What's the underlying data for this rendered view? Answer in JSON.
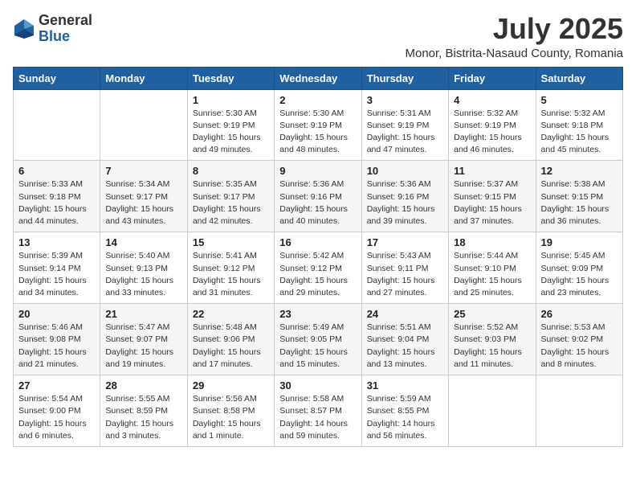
{
  "header": {
    "logo_general": "General",
    "logo_blue": "Blue",
    "month_year": "July 2025",
    "location": "Monor, Bistrita-Nasaud County, Romania"
  },
  "weekdays": [
    "Sunday",
    "Monday",
    "Tuesday",
    "Wednesday",
    "Thursday",
    "Friday",
    "Saturday"
  ],
  "weeks": [
    [
      {
        "day": "",
        "info": ""
      },
      {
        "day": "",
        "info": ""
      },
      {
        "day": "1",
        "info": "Sunrise: 5:30 AM\nSunset: 9:19 PM\nDaylight: 15 hours\nand 49 minutes."
      },
      {
        "day": "2",
        "info": "Sunrise: 5:30 AM\nSunset: 9:19 PM\nDaylight: 15 hours\nand 48 minutes."
      },
      {
        "day": "3",
        "info": "Sunrise: 5:31 AM\nSunset: 9:19 PM\nDaylight: 15 hours\nand 47 minutes."
      },
      {
        "day": "4",
        "info": "Sunrise: 5:32 AM\nSunset: 9:19 PM\nDaylight: 15 hours\nand 46 minutes."
      },
      {
        "day": "5",
        "info": "Sunrise: 5:32 AM\nSunset: 9:18 PM\nDaylight: 15 hours\nand 45 minutes."
      }
    ],
    [
      {
        "day": "6",
        "info": "Sunrise: 5:33 AM\nSunset: 9:18 PM\nDaylight: 15 hours\nand 44 minutes."
      },
      {
        "day": "7",
        "info": "Sunrise: 5:34 AM\nSunset: 9:17 PM\nDaylight: 15 hours\nand 43 minutes."
      },
      {
        "day": "8",
        "info": "Sunrise: 5:35 AM\nSunset: 9:17 PM\nDaylight: 15 hours\nand 42 minutes."
      },
      {
        "day": "9",
        "info": "Sunrise: 5:36 AM\nSunset: 9:16 PM\nDaylight: 15 hours\nand 40 minutes."
      },
      {
        "day": "10",
        "info": "Sunrise: 5:36 AM\nSunset: 9:16 PM\nDaylight: 15 hours\nand 39 minutes."
      },
      {
        "day": "11",
        "info": "Sunrise: 5:37 AM\nSunset: 9:15 PM\nDaylight: 15 hours\nand 37 minutes."
      },
      {
        "day": "12",
        "info": "Sunrise: 5:38 AM\nSunset: 9:15 PM\nDaylight: 15 hours\nand 36 minutes."
      }
    ],
    [
      {
        "day": "13",
        "info": "Sunrise: 5:39 AM\nSunset: 9:14 PM\nDaylight: 15 hours\nand 34 minutes."
      },
      {
        "day": "14",
        "info": "Sunrise: 5:40 AM\nSunset: 9:13 PM\nDaylight: 15 hours\nand 33 minutes."
      },
      {
        "day": "15",
        "info": "Sunrise: 5:41 AM\nSunset: 9:12 PM\nDaylight: 15 hours\nand 31 minutes."
      },
      {
        "day": "16",
        "info": "Sunrise: 5:42 AM\nSunset: 9:12 PM\nDaylight: 15 hours\nand 29 minutes."
      },
      {
        "day": "17",
        "info": "Sunrise: 5:43 AM\nSunset: 9:11 PM\nDaylight: 15 hours\nand 27 minutes."
      },
      {
        "day": "18",
        "info": "Sunrise: 5:44 AM\nSunset: 9:10 PM\nDaylight: 15 hours\nand 25 minutes."
      },
      {
        "day": "19",
        "info": "Sunrise: 5:45 AM\nSunset: 9:09 PM\nDaylight: 15 hours\nand 23 minutes."
      }
    ],
    [
      {
        "day": "20",
        "info": "Sunrise: 5:46 AM\nSunset: 9:08 PM\nDaylight: 15 hours\nand 21 minutes."
      },
      {
        "day": "21",
        "info": "Sunrise: 5:47 AM\nSunset: 9:07 PM\nDaylight: 15 hours\nand 19 minutes."
      },
      {
        "day": "22",
        "info": "Sunrise: 5:48 AM\nSunset: 9:06 PM\nDaylight: 15 hours\nand 17 minutes."
      },
      {
        "day": "23",
        "info": "Sunrise: 5:49 AM\nSunset: 9:05 PM\nDaylight: 15 hours\nand 15 minutes."
      },
      {
        "day": "24",
        "info": "Sunrise: 5:51 AM\nSunset: 9:04 PM\nDaylight: 15 hours\nand 13 minutes."
      },
      {
        "day": "25",
        "info": "Sunrise: 5:52 AM\nSunset: 9:03 PM\nDaylight: 15 hours\nand 11 minutes."
      },
      {
        "day": "26",
        "info": "Sunrise: 5:53 AM\nSunset: 9:02 PM\nDaylight: 15 hours\nand 8 minutes."
      }
    ],
    [
      {
        "day": "27",
        "info": "Sunrise: 5:54 AM\nSunset: 9:00 PM\nDaylight: 15 hours\nand 6 minutes."
      },
      {
        "day": "28",
        "info": "Sunrise: 5:55 AM\nSunset: 8:59 PM\nDaylight: 15 hours\nand 3 minutes."
      },
      {
        "day": "29",
        "info": "Sunrise: 5:56 AM\nSunset: 8:58 PM\nDaylight: 15 hours\nand 1 minute."
      },
      {
        "day": "30",
        "info": "Sunrise: 5:58 AM\nSunset: 8:57 PM\nDaylight: 14 hours\nand 59 minutes."
      },
      {
        "day": "31",
        "info": "Sunrise: 5:59 AM\nSunset: 8:55 PM\nDaylight: 14 hours\nand 56 minutes."
      },
      {
        "day": "",
        "info": ""
      },
      {
        "day": "",
        "info": ""
      }
    ]
  ]
}
